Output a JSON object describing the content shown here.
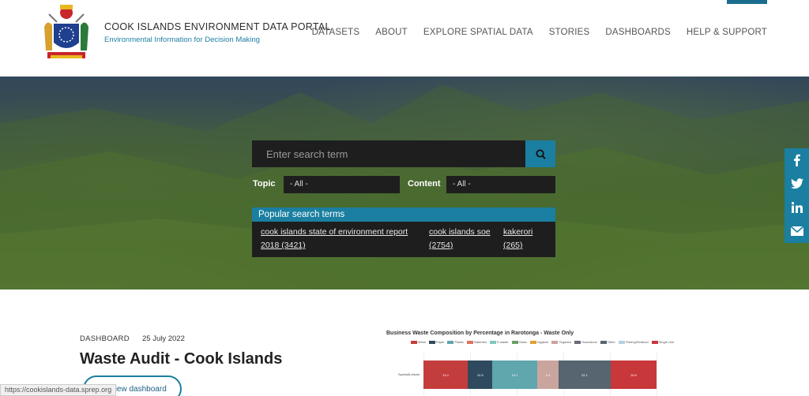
{
  "site": {
    "title": "COOK ISLANDS ENVIRONMENT DATA PORTAL",
    "subtitle": "Environmental Information for Decision Making"
  },
  "nav": {
    "items": [
      "DATASETS",
      "ABOUT",
      "EXPLORE SPATIAL DATA",
      "STORIES",
      "DASHBOARDS",
      "HELP & SUPPORT"
    ]
  },
  "search": {
    "placeholder": "Enter search term",
    "topic_label": "Topic",
    "topic_value": "- All -",
    "content_label": "Content",
    "content_value": "- All -"
  },
  "popular": {
    "heading": "Popular search terms",
    "terms": [
      {
        "line1": "cook islands state of environment report",
        "line2": "2018 (3421)"
      },
      {
        "line1": "cook islands soe",
        "line2": "(2754)"
      },
      {
        "line1": "kakerori",
        "line2": "(265)"
      }
    ]
  },
  "social": [
    "facebook-icon",
    "twitter-icon",
    "linkedin-icon",
    "email-icon"
  ],
  "featured": {
    "type": "DASHBOARD",
    "date": "25 July 2022",
    "title": "Waste Audit - Cook Islands",
    "button": "View dashboard"
  },
  "status_url": "https://cookislands-data.sprep.org",
  "chart_data": {
    "type": "bar",
    "title": "Business Waste Composition by Percentage in Rarotonga - Waste Only",
    "categories": [
      "Sports&Leisure"
    ],
    "series": [
      {
        "name": "Metal",
        "values": [
          19.1
        ],
        "color": "#c43d3d"
      },
      {
        "name": "Paper",
        "values": [
          10.5
        ],
        "color": "#2f4a5e"
      },
      {
        "name": "Plastic",
        "values": [
          19.1
        ],
        "color": "#5fa6ad"
      },
      {
        "name": "Batteries",
        "values": [
          0
        ],
        "color": "#e0705a"
      },
      {
        "name": "E-waste",
        "values": [
          0
        ],
        "color": "#7fc8c0"
      },
      {
        "name": "Glass",
        "values": [
          0
        ],
        "color": "#6aa06a"
      },
      {
        "name": "Hygiene",
        "values": [
          0
        ],
        "color": "#e0a030"
      },
      {
        "name": "Organics",
        "values": [
          9.4
        ],
        "color": "#c9a59d"
      },
      {
        "name": "Hazardous",
        "values": [
          0
        ],
        "color": "#666c74"
      },
      {
        "name": "Other",
        "values": [
          22.1
        ],
        "color": "#56656f"
      },
      {
        "name": "Fishing/Seafood",
        "values": [
          0
        ],
        "color": "#b8d0e0"
      },
      {
        "name": "Single Use",
        "values": [
          19.8
        ],
        "color": "#c8373a"
      }
    ]
  }
}
